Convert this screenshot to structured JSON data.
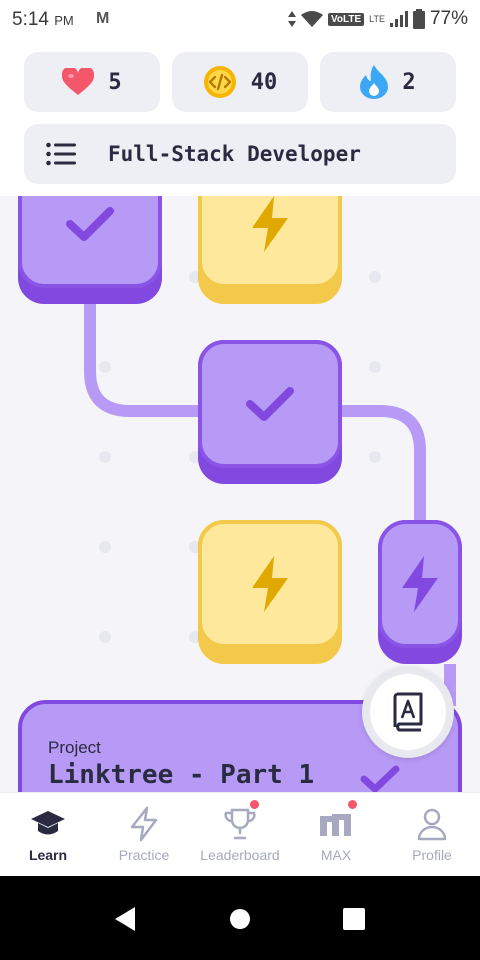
{
  "status_bar": {
    "time": "5:14",
    "ampm": "PM",
    "app_icon": "M",
    "volte": "VoLTE",
    "lte": "LTE",
    "battery": "77%"
  },
  "stats": {
    "hearts": "5",
    "coins": "40",
    "streak": "2"
  },
  "track": {
    "title": "Full-Stack Developer"
  },
  "project": {
    "label": "Project",
    "name": "Linktree - Part 1"
  },
  "nav": {
    "items": [
      {
        "label": "Learn"
      },
      {
        "label": "Practice"
      },
      {
        "label": "Leaderboard"
      },
      {
        "label": "MAX"
      },
      {
        "label": "Profile"
      }
    ]
  },
  "colors": {
    "purple_dark": "#8249e0",
    "purple_light": "#b79af6",
    "yellow": "#f2c94a",
    "yellow_light": "#fde89c",
    "text_dark": "#2a2b40",
    "muted": "#a7a9c0",
    "badge": "#f4566a"
  },
  "icons": {
    "hearts": "heart-icon",
    "coins": "code-coin-icon",
    "streak": "flame-icon",
    "menu": "list-icon",
    "done": "check-icon",
    "practice": "lightning-icon",
    "handbook": "book-icon"
  }
}
